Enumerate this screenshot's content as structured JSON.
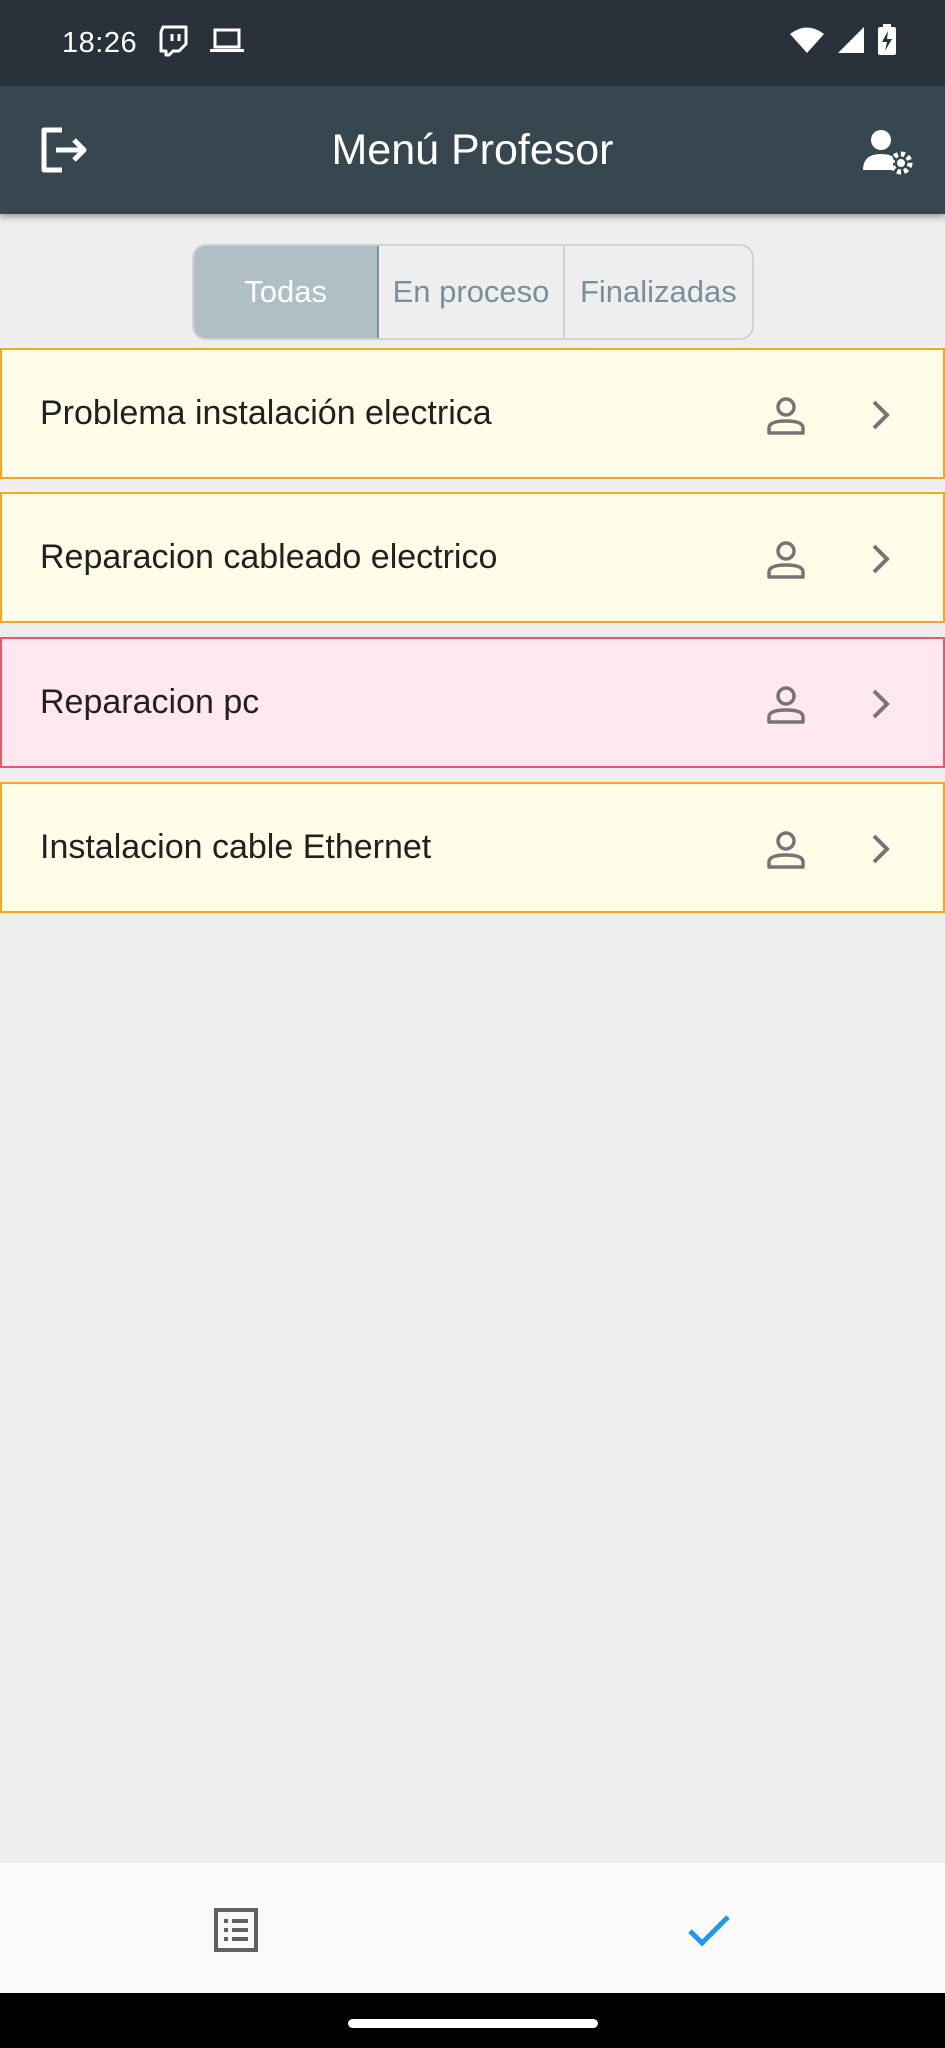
{
  "status_bar": {
    "time": "18:26",
    "icons": [
      "twitch-icon",
      "laptop-icon",
      "wifi-icon",
      "signal-icon",
      "battery-charging-icon"
    ]
  },
  "app_bar": {
    "title": "Menú Profesor",
    "left_icon": "logout-icon",
    "right_icon": "user-settings-icon",
    "background": "#37474f"
  },
  "filter_tabs": {
    "items": [
      {
        "label": "Todas",
        "active": true
      },
      {
        "label": "En proceso",
        "active": false
      },
      {
        "label": "Finalizadas",
        "active": false
      }
    ]
  },
  "incidents": [
    {
      "title": "Problema instalación electrica",
      "status_color": "#f5a623"
    },
    {
      "title": "Reparacion cableado electrico",
      "status_color": "#f5a623"
    },
    {
      "title": "Reparacion pc",
      "status_color": "#e35a6a"
    },
    {
      "title": "Instalacion cable Ethernet",
      "status_color": "#f5a623"
    }
  ],
  "bottom_nav": {
    "items": [
      {
        "icon": "list-icon",
        "active": false
      },
      {
        "icon": "check-icon",
        "active": true,
        "color": "#2196f3"
      }
    ]
  }
}
